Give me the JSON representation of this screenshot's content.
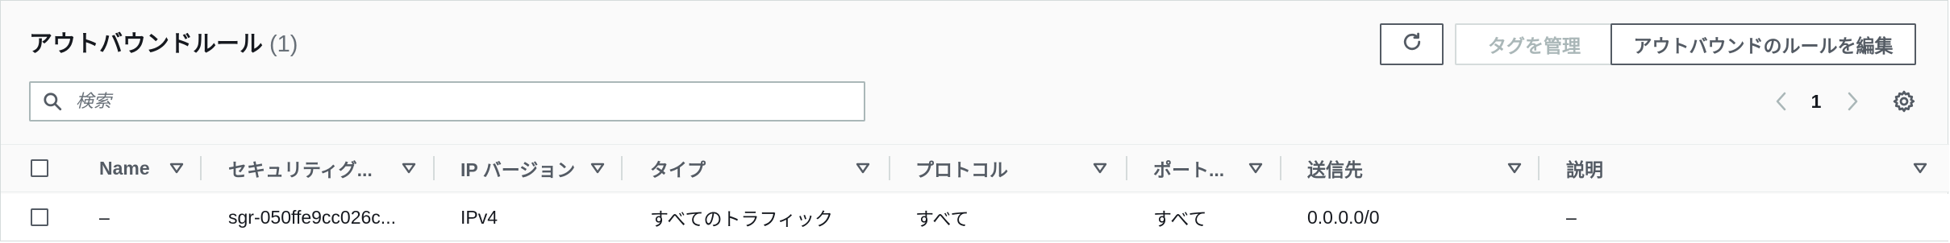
{
  "header": {
    "title": "アウトバウンドルール",
    "count": "(1)"
  },
  "toolbar": {
    "refresh_icon": "refresh-icon",
    "manage_tags_label": "タグを管理",
    "edit_rules_label": "アウトバウンドのルールを編集"
  },
  "search": {
    "placeholder": "検索",
    "value": ""
  },
  "pagination": {
    "current_page": "1"
  },
  "table": {
    "columns": [
      {
        "label": "Name"
      },
      {
        "label": "セキュリティグ..."
      },
      {
        "label": "IP バージョン"
      },
      {
        "label": "タイプ"
      },
      {
        "label": "プロトコル"
      },
      {
        "label": "ポート..."
      },
      {
        "label": "送信先"
      },
      {
        "label": "説明"
      }
    ],
    "rows": [
      {
        "name": "–",
        "rule_id": "sgr-050ffe9cc026c...",
        "ip_version": "IPv4",
        "type": "すべてのトラフィック",
        "protocol": "すべて",
        "port": "すべて",
        "destination": "0.0.0.0/0",
        "description": "–"
      }
    ]
  },
  "colors": {
    "text": "#16191f",
    "secondary": "#545b64",
    "disabled": "#aab7b8",
    "border": "#d5dbdb"
  }
}
